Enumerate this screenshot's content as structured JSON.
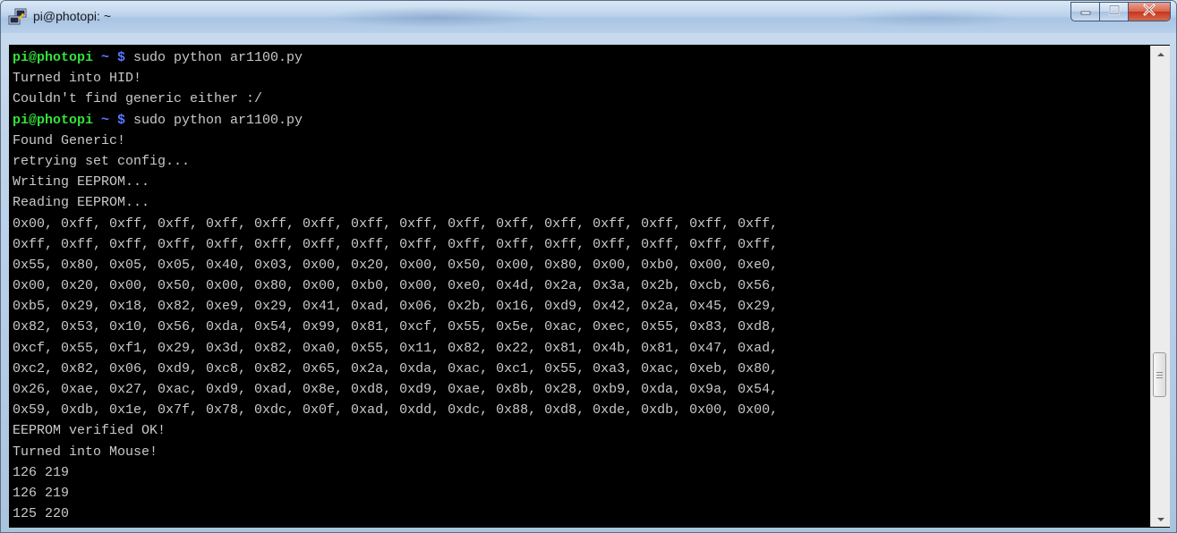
{
  "window": {
    "title": "pi@photopi: ~",
    "icons": {
      "app": "putty-icon",
      "minimize": "minimize-icon",
      "maximize": "maximize-icon",
      "close": "close-icon"
    },
    "colors": {
      "background": "#000000",
      "text": "#c9c9c9",
      "prompt_user": "#34e23b",
      "prompt_path": "#5b78ff",
      "close_button": "#c5351c"
    }
  },
  "terminal": {
    "lines": [
      {
        "user": "pi@photopi",
        "path": " ~ $ ",
        "command": "sudo python ar1100.py"
      },
      {
        "text": "Turned into HID!"
      },
      {
        "text": "Couldn't find generic either :/"
      },
      {
        "user": "pi@photopi",
        "path": " ~ $ ",
        "command": "sudo python ar1100.py"
      },
      {
        "text": "Found Generic!"
      },
      {
        "text": "retrying set config..."
      },
      {
        "text": "Writing EEPROM..."
      },
      {
        "text": "Reading EEPROM..."
      },
      {
        "text": "0x00, 0xff, 0xff, 0xff, 0xff, 0xff, 0xff, 0xff, 0xff, 0xff, 0xff, 0xff, 0xff, 0xff, 0xff, 0xff,"
      },
      {
        "text": "0xff, 0xff, 0xff, 0xff, 0xff, 0xff, 0xff, 0xff, 0xff, 0xff, 0xff, 0xff, 0xff, 0xff, 0xff, 0xff,"
      },
      {
        "text": "0x55, 0x80, 0x05, 0x05, 0x40, 0x03, 0x00, 0x20, 0x00, 0x50, 0x00, 0x80, 0x00, 0xb0, 0x00, 0xe0,"
      },
      {
        "text": "0x00, 0x20, 0x00, 0x50, 0x00, 0x80, 0x00, 0xb0, 0x00, 0xe0, 0x4d, 0x2a, 0x3a, 0x2b, 0xcb, 0x56,"
      },
      {
        "text": "0xb5, 0x29, 0x18, 0x82, 0xe9, 0x29, 0x41, 0xad, 0x06, 0x2b, 0x16, 0xd9, 0x42, 0x2a, 0x45, 0x29,"
      },
      {
        "text": "0x82, 0x53, 0x10, 0x56, 0xda, 0x54, 0x99, 0x81, 0xcf, 0x55, 0x5e, 0xac, 0xec, 0x55, 0x83, 0xd8,"
      },
      {
        "text": "0xcf, 0x55, 0xf1, 0x29, 0x3d, 0x82, 0xa0, 0x55, 0x11, 0x82, 0x22, 0x81, 0x4b, 0x81, 0x47, 0xad,"
      },
      {
        "text": "0xc2, 0x82, 0x06, 0xd9, 0xc8, 0x82, 0x65, 0x2a, 0xda, 0xac, 0xc1, 0x55, 0xa3, 0xac, 0xeb, 0x80,"
      },
      {
        "text": "0x26, 0xae, 0x27, 0xac, 0xd9, 0xad, 0x8e, 0xd8, 0xd9, 0xae, 0x8b, 0x28, 0xb9, 0xda, 0x9a, 0x54,"
      },
      {
        "text": "0x59, 0xdb, 0x1e, 0x7f, 0x78, 0xdc, 0x0f, 0xad, 0xdd, 0xdc, 0x88, 0xd8, 0xde, 0xdb, 0x00, 0x00,"
      },
      {
        "text": "EEPROM verified OK!"
      },
      {
        "text": "Turned into Mouse!"
      },
      {
        "text": "126 219"
      },
      {
        "text": "126 219"
      },
      {
        "text": "125 220"
      }
    ]
  }
}
